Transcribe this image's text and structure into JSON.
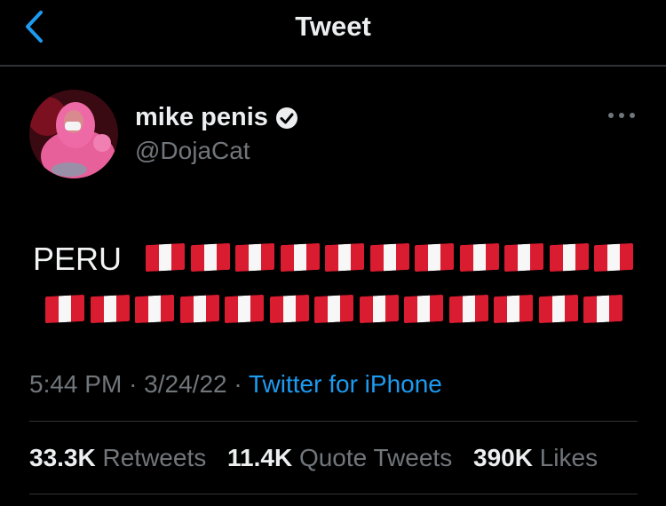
{
  "header": {
    "title": "Tweet",
    "back_icon": "chevron-left-icon"
  },
  "author": {
    "name": "mike penis",
    "handle": "@DojaCat",
    "verified_icon": "verified-badge-icon",
    "more_icon": "more-horizontal-icon"
  },
  "tweet": {
    "text_prefix": "PERU",
    "flag_emoji": "🇵🇪",
    "flag_count": 24,
    "time": "5:44 PM",
    "date": "3/24/22",
    "separator": "·",
    "source": "Twitter for iPhone"
  },
  "stats": {
    "retweets_count": "33.3K",
    "retweets_label": "Retweets",
    "quotes_count": "11.4K",
    "quotes_label": "Quote Tweets",
    "likes_count": "390K",
    "likes_label": "Likes"
  },
  "colors": {
    "background": "#000000",
    "accent": "#1d9bf0",
    "secondary_text": "#71767b",
    "flag_red": "#d91c2f"
  }
}
